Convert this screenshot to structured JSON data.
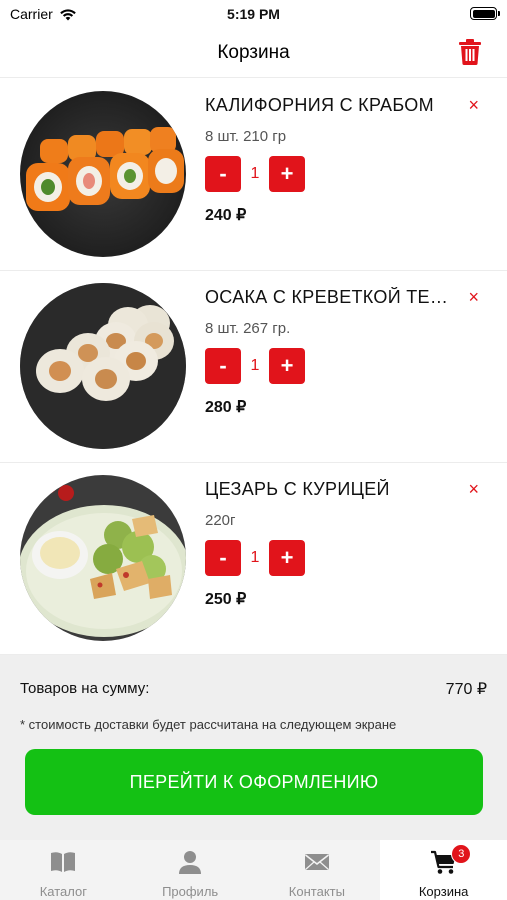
{
  "status_bar": {
    "carrier": "Carrier",
    "time": "5:19 PM"
  },
  "nav": {
    "title": "Корзина"
  },
  "cart": {
    "items": [
      {
        "name": "КАЛИФОРНИЯ С КРАБОМ",
        "weight": "8 шт. 210 гр",
        "quantity": "1",
        "price": "240 ₽",
        "minus": "-",
        "plus": "+",
        "remove": "×"
      },
      {
        "name": "ОСАКА С КРЕВЕТКОЙ ТЕМПУРА",
        "weight": "8 шт. 267 гр.",
        "quantity": "1",
        "price": "280 ₽",
        "minus": "-",
        "plus": "+",
        "remove": "×"
      },
      {
        "name": "ЦЕЗАРЬ С КУРИЦЕЙ",
        "weight": "220г",
        "quantity": "1",
        "price": "250 ₽",
        "minus": "-",
        "plus": "+",
        "remove": "×"
      }
    ]
  },
  "summary": {
    "label": "Товаров на сумму:",
    "total": "770 ₽",
    "note": "* стоимость доставки будет рассчитана на следующем экране",
    "checkout_label": "ПЕРЕЙТИ К ОФОРМЛЕНИЮ"
  },
  "tabs": [
    {
      "label": "Каталог",
      "icon": "book-icon",
      "active": false
    },
    {
      "label": "Профиль",
      "icon": "person-icon",
      "active": false
    },
    {
      "label": "Контакты",
      "icon": "envelope-icon",
      "active": false
    },
    {
      "label": "Корзина",
      "icon": "cart-icon",
      "active": true,
      "badge": "3"
    }
  ],
  "colors": {
    "accent": "#e1141b",
    "checkout": "#14c114",
    "tab_bar": "#f3f3f3"
  }
}
